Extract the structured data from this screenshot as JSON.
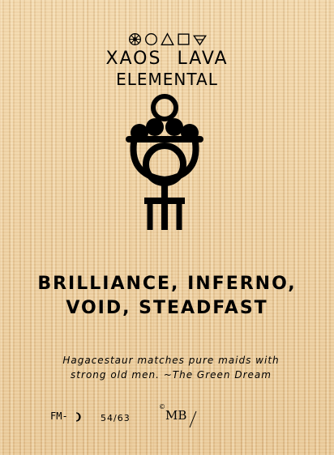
{
  "card": {
    "elemental_glyphs": [
      "wheel-of-dharma-icon",
      "circle-icon",
      "triangle-icon",
      "square-icon",
      "inverted-triangle-icon"
    ],
    "title_line1": "XAOS LAVA",
    "title_line2": "ELEMENTAL",
    "sigil_icon": "ring-cup-venus-sigil-icon",
    "traits_line1": "BRILLIANCE, INFERNO,",
    "traits_line2": "VOID, STEADFAST",
    "flavor_text": "Hagacestaur matches pure maids with strong old men. ~The Green Dream",
    "code": "FM-",
    "code_icon": "crescent-moon-icon",
    "card_number": "54/63",
    "copyright_symbol": "©",
    "artist_initials": "MB"
  },
  "colors": {
    "ink": "#000000",
    "papyrus": "#e9c99a"
  }
}
